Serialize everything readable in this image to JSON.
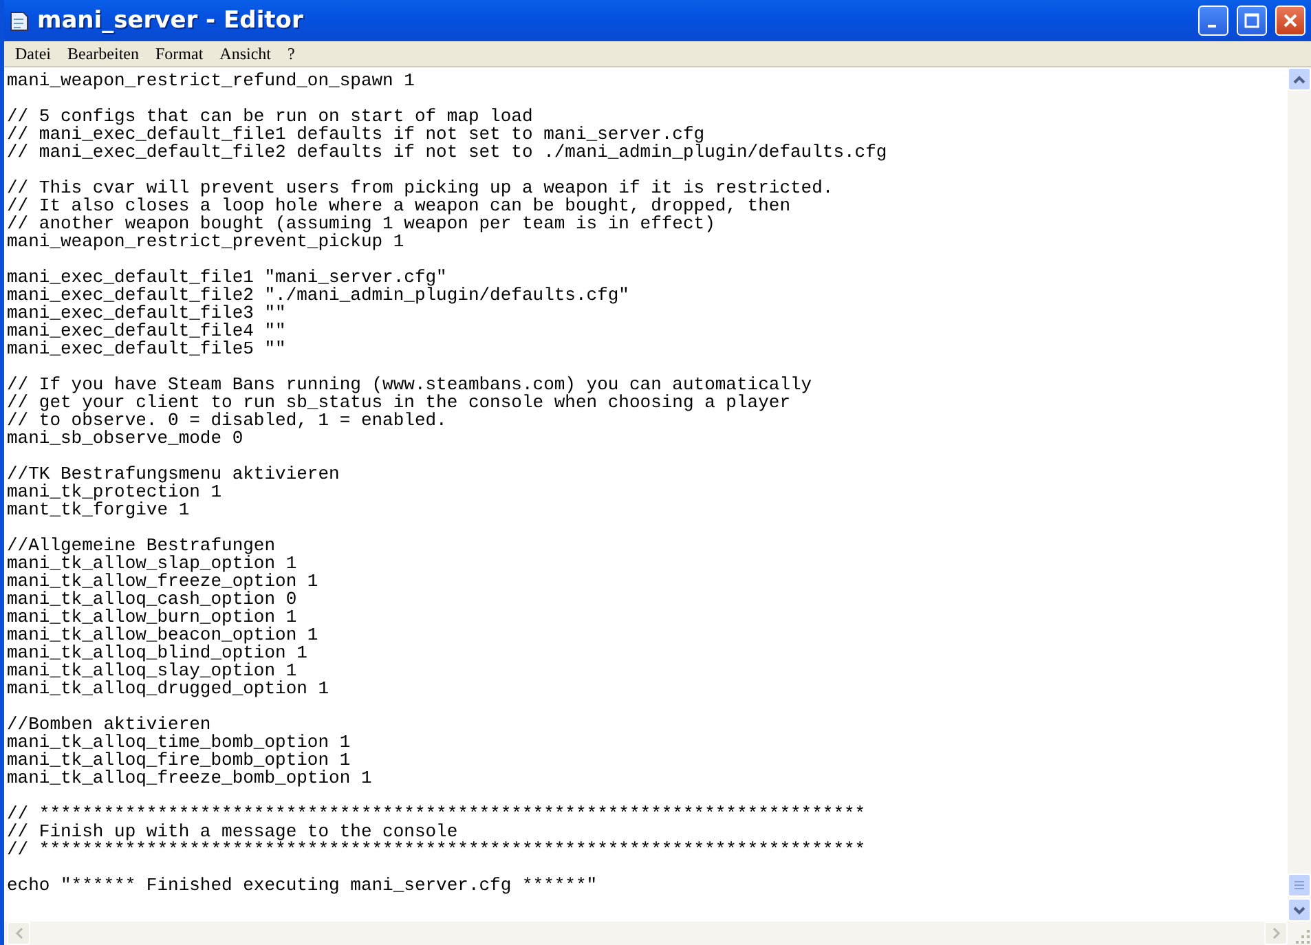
{
  "window": {
    "title": "mani_server - Editor"
  },
  "menu": [
    "Datei",
    "Bearbeiten",
    "Format",
    "Ansicht",
    "?"
  ],
  "document": {
    "blocks": [
      {
        "lines": [
          "mani_weapon_restrict_refund_on_spawn 1"
        ]
      },
      {
        "lines": [
          "// 5 configs that can be run on start of map load",
          "// mani_exec_default_file1 defaults if not set to mani_server.cfg",
          "// mani_exec_default_file2 defaults if not set to ./mani_admin_plugin/defaults.cfg"
        ]
      },
      {
        "lines": [
          "// This cvar will prevent users from picking up a weapon if it is restricted.",
          "// It also closes a loop hole where a weapon can be bought, dropped, then",
          "// another weapon bought (assuming 1 weapon per team is in effect)",
          "mani_weapon_restrict_prevent_pickup 1"
        ]
      },
      {
        "lines": [
          "mani_exec_default_file1 \"mani_server.cfg\"",
          "mani_exec_default_file2 \"./mani_admin_plugin/defaults.cfg\"",
          "mani_exec_default_file3 \"\"",
          "mani_exec_default_file4 \"\"",
          "mani_exec_default_file5 \"\""
        ]
      },
      {
        "lines": [
          "// If you have Steam Bans running (www.steambans.com) you can automatically",
          "// get your client to run sb_status in the console when choosing a player",
          "// to observe. 0 = disabled, 1 = enabled.",
          "mani_sb_observe_mode 0"
        ]
      },
      {
        "lines": [
          "//TK Bestrafungsmenu aktivieren",
          "mani_tk_protection 1",
          "mant_tk_forgive 1"
        ]
      },
      {
        "lines": [
          "//Allgemeine Bestrafungen",
          "mani_tk_allow_slap_option 1",
          "mani_tk_allow_freeze_option 1",
          "mani_tk_alloq_cash_option 0",
          "mani_tk_allow_burn_option 1",
          "mani_tk_allow_beacon_option 1",
          "mani_tk_alloq_blind_option 1",
          "mani_tk_alloq_slay_option 1",
          "mani_tk_alloq_drugged_option 1"
        ]
      },
      {
        "lines": [
          "//Bomben aktivieren",
          "mani_tk_alloq_time_bomb_option 1",
          "mani_tk_alloq_fire_bomb_option 1",
          "mani_tk_alloq_freeze_bomb_option 1"
        ]
      },
      {
        "lines": [
          "// *****************************************************************************",
          "// Finish up with a message to the console",
          "// *****************************************************************************"
        ]
      },
      {
        "lines": [
          "echo \"****** Finished executing mani_server.cfg ******\""
        ]
      }
    ]
  }
}
